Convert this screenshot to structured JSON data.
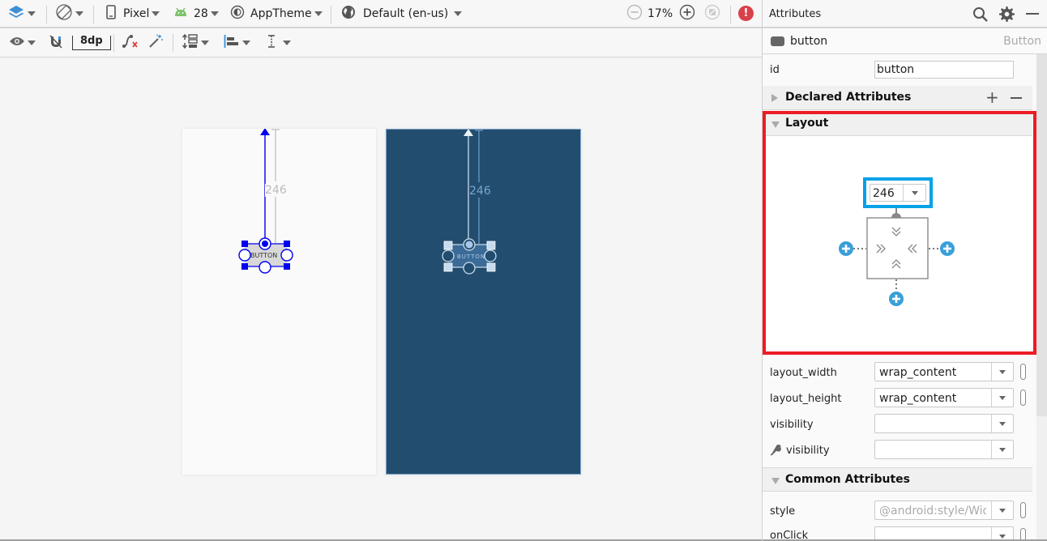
{
  "toolbar_top": {
    "layers_icon": "layers-icon",
    "orientation_icon": "rotate-device-icon",
    "device": "Pixel",
    "api_level": "28",
    "theme": "AppTheme",
    "locale": "Default (en-us)",
    "zoom_level": "17%",
    "error_icon_label": "!"
  },
  "toolbar_second": {
    "margin_value": "8dp"
  },
  "canvas": {
    "design": {
      "button_text": "BUTTON",
      "margin_top_label": "246"
    },
    "blueprint": {
      "button_text": "BUTTON",
      "margin_top_label": "246"
    },
    "colors": {
      "design_accent": "#0000ee",
      "blueprint_bg": "#234d6e",
      "blueprint_line": "#a8c8e8"
    }
  },
  "attributes": {
    "title": "Attributes",
    "component_name": "button",
    "component_type": "Button",
    "id_label": "id",
    "id_value": "button",
    "declared_section": "Declared Attributes",
    "layout_section": "Layout",
    "constraint_margin_top": "246",
    "rows": [
      {
        "label": "layout_width",
        "value": "wrap_content"
      },
      {
        "label": "layout_height",
        "value": "wrap_content"
      },
      {
        "label": "visibility",
        "value": ""
      },
      {
        "label": "visibility",
        "value": ""
      }
    ],
    "common_section": "Common Attributes",
    "common_rows": [
      {
        "label": "style",
        "value": "@android:style/Widget.Material.Button"
      },
      {
        "label": "onClick",
        "value": ""
      }
    ],
    "highlight_colors": {
      "layout_box": "#ec1c24",
      "margin_box": "#00a2e8",
      "add_constraint": "#3a9fd8"
    }
  }
}
